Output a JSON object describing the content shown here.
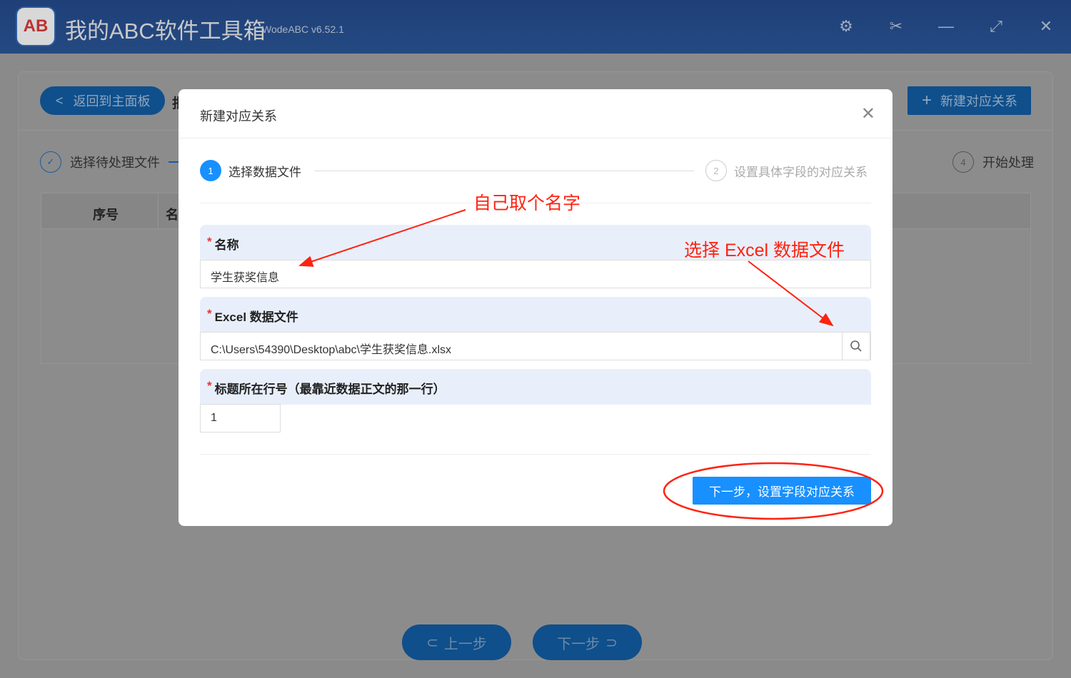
{
  "app": {
    "title": "我的ABC软件工具箱",
    "version": "WodeABC v6.52.1",
    "logo_text": "AB",
    "controls": [
      "settings",
      "scissors",
      "minimize",
      "maximize",
      "close"
    ]
  },
  "background": {
    "back_button": "返回到主面板",
    "partial_title": "批",
    "new_button": "新建对应关系",
    "steps": [
      {
        "label": "选择待处理文件"
      },
      {
        "number": "4",
        "label": "开始处理"
      }
    ],
    "table_headers": [
      "序号",
      "名"
    ],
    "prev_button": "上一步",
    "next_button": "下一步"
  },
  "dialog": {
    "title": "新建对应关系",
    "steps": [
      {
        "number": "1",
        "label": "选择数据文件"
      },
      {
        "number": "2",
        "label": "设置具体字段的对应关系"
      }
    ],
    "fields": {
      "name": {
        "label": "名称",
        "value": "学生获奖信息"
      },
      "excel": {
        "label": "Excel 数据文件",
        "value": "C:\\Users\\54390\\Desktop\\abc\\学生获奖信息.xlsx"
      },
      "header_row": {
        "label": "标题所在行号（最靠近数据正文的那一行）",
        "value": "1"
      }
    },
    "submit": "下一步，设置字段对应关系"
  },
  "annotations": {
    "name_hint": "自己取个名字",
    "file_hint": "选择 Excel 数据文件",
    "color": "#ff2200"
  }
}
